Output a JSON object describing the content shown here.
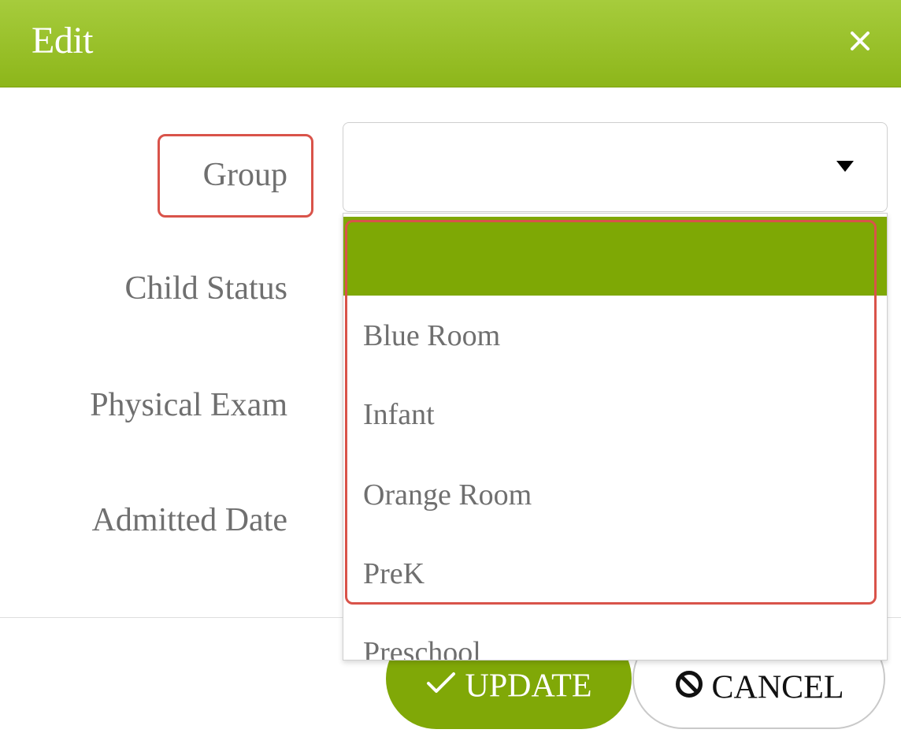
{
  "header": {
    "title": "Edit",
    "close_icon": "close-icon"
  },
  "form": {
    "labels": {
      "group": "Group",
      "child_status": "Child Status",
      "physical_exam": "Physical Exam",
      "admitted_date": "Admitted Date"
    },
    "group_select": {
      "value": "",
      "options": [
        "",
        "Blue Room",
        "Infant",
        "Orange Room",
        "PreK",
        "Preschool"
      ]
    }
  },
  "actions": {
    "update_label": "UPDATE",
    "cancel_label": "CANCEL",
    "update_icon": "checkmark-icon",
    "cancel_icon": "ban-icon"
  },
  "colors": {
    "header": "#94bd22",
    "selected_option": "#7ea805",
    "update_button": "#80a807",
    "highlight": "#d9534a"
  }
}
